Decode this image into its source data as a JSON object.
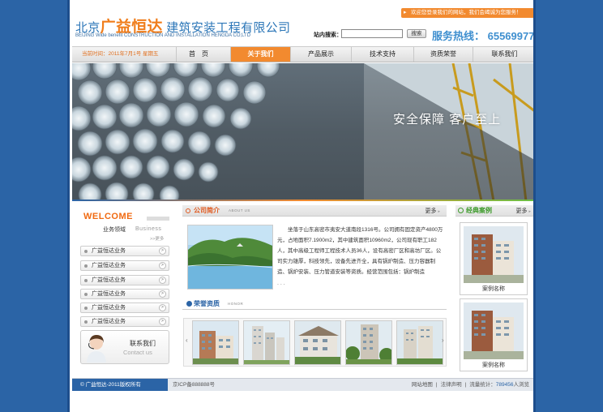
{
  "header": {
    "logo_cn_prefix": "北京",
    "logo_cn_big": "广益恒达",
    "logo_cn_suffix": "建筑安装工程有限公司",
    "logo_en": "BEIJING Wide benefit CONSTRUCTION AND INSTALLATION HENGDA CO;LTD",
    "welcome": "欢迎您登录我们的网站，我们会竭诚为您服务！",
    "search_label": "站内搜索：",
    "search_value": "",
    "search_button": "搜索",
    "hotline": "服务热线： 65569977"
  },
  "nav": {
    "date": "当前时间：2011年7月1号 星期五",
    "items": [
      {
        "label": "首　页",
        "active": false
      },
      {
        "label": "关于我们",
        "active": true
      },
      {
        "label": "产品展示",
        "active": false
      },
      {
        "label": "技术支持",
        "active": false
      },
      {
        "label": "资质荣誉",
        "active": false
      },
      {
        "label": "联系我们",
        "active": false
      }
    ]
  },
  "banner": {
    "slogan": "安全保障  客户至上"
  },
  "left": {
    "welcome": "WELCOME",
    "sub": "业务领域",
    "sub_en": "Business",
    "more": ">>更多",
    "items": [
      "广益恒达业务",
      "广益恒达业务",
      "广益恒达业务",
      "广益恒达业务",
      "广益恒达业务",
      "广益恒达业务"
    ],
    "contact_cn": "联系我们",
    "contact_en": "Contact us"
  },
  "about": {
    "title": "公司简介",
    "title_en": "ABOUT US",
    "more": "更多",
    "text": "坐落于山东高密市夷安大道南段1316号。公司拥有固定资产4800万元，占地面积7.1900m2，其中建筑面积10960m2，公司现有职工182人，其中高级工程师工程技术人员36人，设有高密厂区和高坊厂区。公司实力雄厚，科技领先，设备先进齐全，具有锅炉制造、压力容器制造、锅炉安装、压力管道安装等资质。经营范围包括：锅炉制造",
    "ellipsis": ". . ."
  },
  "honor": {
    "title": "荣誉资质",
    "title_en": "HONOR"
  },
  "cases": {
    "title": "经典案例",
    "more": "更多",
    "items": [
      {
        "name": "案例名称"
      },
      {
        "name": "案例名称"
      }
    ]
  },
  "footer": {
    "copyright": "©   广益恒达-2011版权所有",
    "icp": "京ICP备888888号",
    "link_sitemap": "网站地图",
    "link_legal": "法律声明",
    "stats_label": "流量统计：",
    "stats_num": "789456",
    "stats_suffix": "人浏览"
  },
  "colors": {
    "brand_blue": "#2b64a6",
    "accent_orange": "#f28a2f",
    "green": "#3d9a2a"
  }
}
